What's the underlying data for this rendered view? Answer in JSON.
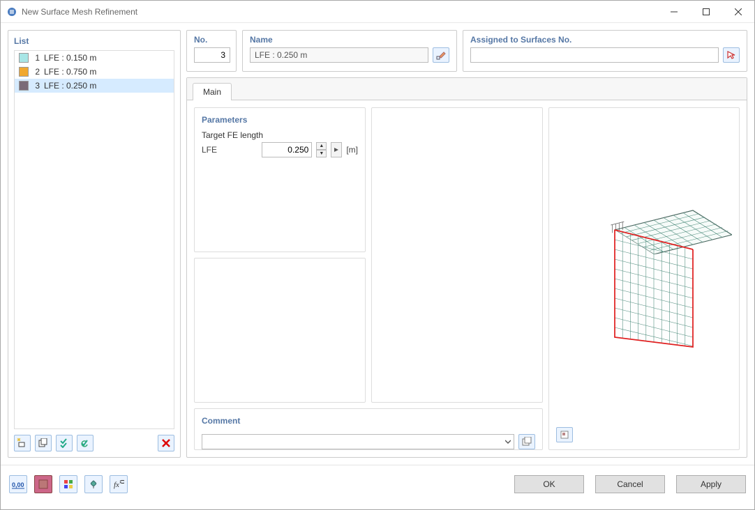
{
  "window": {
    "title": "New Surface Mesh Refinement"
  },
  "list": {
    "title": "List",
    "items": [
      {
        "num": "1",
        "label": "LFE : 0.150 m",
        "color": "#a8e6e6"
      },
      {
        "num": "2",
        "label": "LFE : 0.750 m",
        "color": "#f0a830"
      },
      {
        "num": "3",
        "label": "LFE : 0.250 m",
        "color": "#7a6b78"
      }
    ]
  },
  "no": {
    "label": "No.",
    "value": "3"
  },
  "name": {
    "label": "Name",
    "value": "LFE : 0.250 m"
  },
  "assigned": {
    "label": "Assigned to Surfaces No.",
    "value": ""
  },
  "tabs": {
    "main": "Main"
  },
  "parameters": {
    "title": "Parameters",
    "target_label": "Target FE length",
    "lfe_label": "LFE",
    "lfe_value": "0.250",
    "unit": "[m]"
  },
  "comment": {
    "title": "Comment"
  },
  "buttons": {
    "ok": "OK",
    "cancel": "Cancel",
    "apply": "Apply"
  }
}
